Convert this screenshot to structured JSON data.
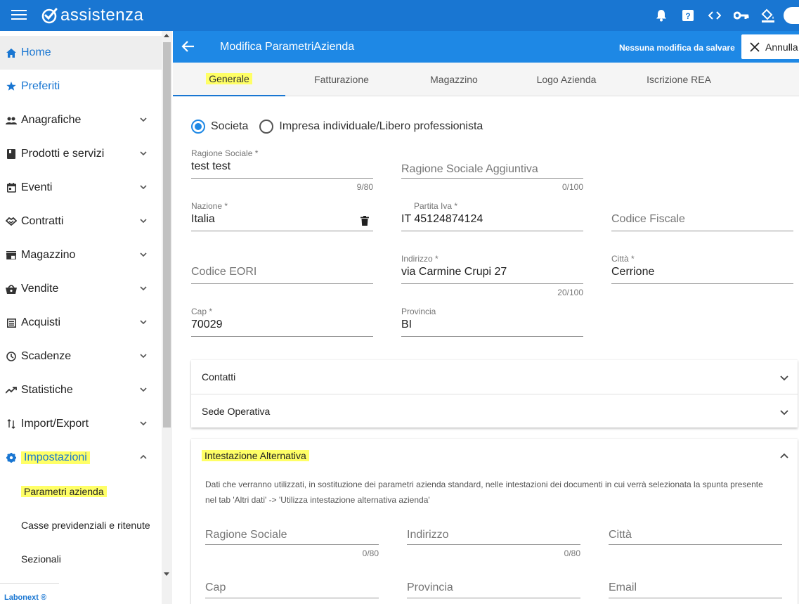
{
  "app": {
    "brand": "assistenza"
  },
  "sidebar": {
    "items": [
      {
        "label": "Home",
        "icon": "home-icon"
      },
      {
        "label": "Preferiti",
        "icon": "star-icon"
      },
      {
        "label": "Anagrafiche",
        "icon": "people-icon"
      },
      {
        "label": "Prodotti e servizi",
        "icon": "book-icon"
      },
      {
        "label": "Eventi",
        "icon": "calendar-icon"
      },
      {
        "label": "Contratti",
        "icon": "handshake-icon"
      },
      {
        "label": "Magazzino",
        "icon": "store-icon"
      },
      {
        "label": "Vendite",
        "icon": "basket-icon"
      },
      {
        "label": "Acquisti",
        "icon": "list-icon"
      },
      {
        "label": "Scadenze",
        "icon": "clock-icon"
      },
      {
        "label": "Statistiche",
        "icon": "trending-icon"
      },
      {
        "label": "Import/Export",
        "icon": "import-export-icon"
      },
      {
        "label": "Impostazioni",
        "icon": "gear-icon"
      }
    ],
    "subitems": [
      {
        "label": "Parametri azienda"
      },
      {
        "label": "Casse previdenziali e ritenute"
      },
      {
        "label": "Sezionali"
      }
    ],
    "footer": "Labonext ®"
  },
  "header": {
    "title": "Modifica ParametriAzienda",
    "status": "Nessuna modifica da salvare",
    "cancel_label": "Annulla"
  },
  "tabs": [
    {
      "label": "Generale"
    },
    {
      "label": "Fatturazione"
    },
    {
      "label": "Magazzino"
    },
    {
      "label": "Logo Azienda"
    },
    {
      "label": "Iscrizione REA"
    }
  ],
  "form": {
    "type_options": [
      {
        "label": "Societa",
        "selected": true
      },
      {
        "label": "Impresa individuale/Libero professionista",
        "selected": false
      }
    ],
    "ragione_sociale": {
      "label": "Ragione Sociale *",
      "value": "test test",
      "counter": "9/80"
    },
    "ragione_sociale_aggiuntiva": {
      "placeholder": "Ragione Sociale Aggiuntiva",
      "counter": "0/100"
    },
    "nazione": {
      "label": "Nazione *",
      "value": "Italia"
    },
    "partita_iva": {
      "label": "Partita Iva *",
      "value": "IT 45124874124"
    },
    "codice_fiscale": {
      "placeholder": "Codice Fiscale"
    },
    "codice_eori": {
      "placeholder": "Codice EORI"
    },
    "indirizzo": {
      "label": "Indirizzo *",
      "value": "via Carmine Crupi 27",
      "counter": "20/100"
    },
    "citta": {
      "label": "Città *",
      "value": "Cerrione"
    },
    "cap": {
      "label": "Cap *",
      "value": "70029"
    },
    "provincia": {
      "label": "Provincia",
      "value": "BI"
    }
  },
  "panels": {
    "contatti": "Contatti",
    "sede_operativa": "Sede Operativa",
    "intestazione": {
      "title": "Intestazione Alternativa",
      "description": "Dati che verranno utilizzati, in sostituzione dei parametri azienda standard, nelle intestazioni dei documenti in cui verrà selezionata la spunta presente nel tab 'Altri dati' -> 'Utilizza intestazione alternativa azienda'",
      "fields": {
        "ragione_sociale": {
          "placeholder": "Ragione Sociale",
          "counter": "0/80"
        },
        "indirizzo": {
          "placeholder": "Indirizzo",
          "counter": "0/80"
        },
        "citta": {
          "placeholder": "Città"
        },
        "cap": {
          "placeholder": "Cap"
        },
        "provincia": {
          "placeholder": "Provincia"
        },
        "email": {
          "placeholder": "Email"
        }
      }
    }
  },
  "colors": {
    "primary": "#1976d2",
    "header": "#1e88e5",
    "highlight": "#ffff66"
  }
}
